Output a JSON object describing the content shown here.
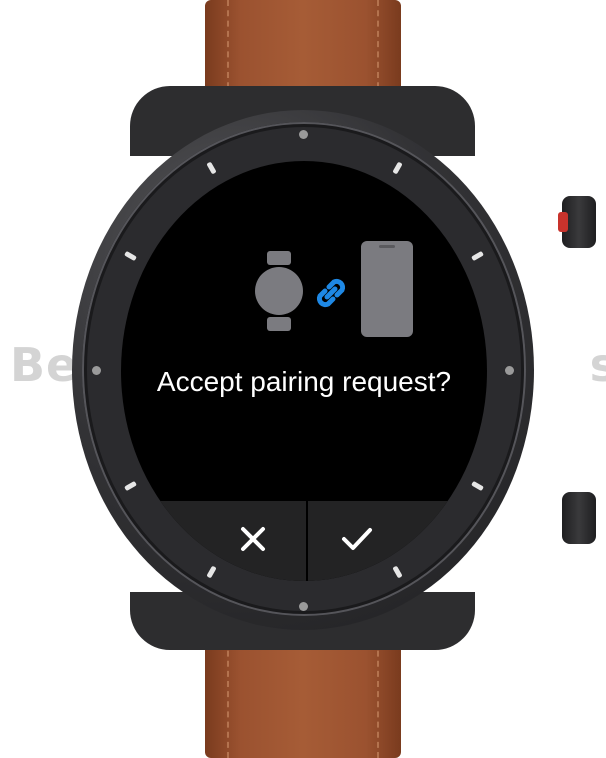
{
  "watermark": {
    "left": "Be",
    "right": "s"
  },
  "dialog": {
    "prompt": "Accept pairing request?",
    "icons": [
      "smartwatch-icon",
      "link-icon",
      "smartphone-icon"
    ],
    "reject_icon": "close-icon",
    "accept_icon": "check-icon"
  },
  "colors": {
    "strap": "#9b5230",
    "case": "#2d2d2f",
    "screen": "#000000",
    "link_accent": "#1e88e5",
    "icon_gray": "#7b7b80",
    "action_bar": "#232324",
    "crown_accent": "#c8332c"
  }
}
